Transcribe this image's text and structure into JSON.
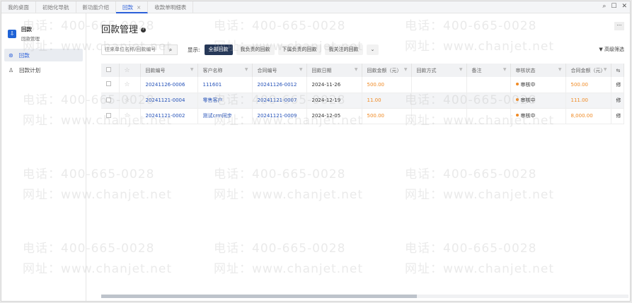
{
  "tabs": [
    {
      "label": "我的桌面"
    },
    {
      "label": "初始化导航"
    },
    {
      "label": "新功能介绍"
    },
    {
      "label": "回款",
      "active": true,
      "close": "×"
    },
    {
      "label": "收款单明细表"
    }
  ],
  "window_controls": {
    "search": "⌕",
    "maximize": "☐",
    "close": "✕"
  },
  "app": {
    "icon": "download-icon",
    "title": "回款",
    "subtitle": "回款管理"
  },
  "sidebar": {
    "items": [
      {
        "label": "回款",
        "icon": "payment-icon",
        "active": true
      },
      {
        "label": "回款计划",
        "icon": "plan-icon"
      }
    ]
  },
  "page": {
    "title": "回款管理",
    "help": "?",
    "more": "···"
  },
  "toolbar": {
    "search_placeholder": "往来单位名称/回款编号",
    "show_label": "显示:",
    "filters": [
      "全部回款",
      "我负责的回款",
      "下属负责的回款",
      "我关注的回款"
    ],
    "active_filter": "全部回款",
    "expand": "⌄",
    "advanced": "▼ 高级筛选"
  },
  "table": {
    "columns": [
      "回款编号",
      "客户名称",
      "合同编号",
      "回款日期",
      "回款金额（元）",
      "回款方式",
      "备注",
      "审核状态",
      "合同金额（元）"
    ],
    "rows": [
      [
        "20241126-0006",
        "111601",
        "20241126-0012",
        "2024-11-26",
        "500.00",
        "",
        "",
        "审核中",
        "500.00",
        "修"
      ],
      [
        "20241121-0004",
        "零售客户",
        "20241121-0007",
        "2024-12-19",
        "11.00",
        "",
        "",
        "审核中",
        "111.00",
        "修"
      ],
      [
        "20241121-0002",
        "测试crm同步",
        "20241121-0009",
        "2024-12-05",
        "500.00",
        "",
        "",
        "审核中",
        "8,000.00",
        "修"
      ]
    ]
  },
  "colors": {
    "accent": "#2b5fd9",
    "link": "#2451b8",
    "amount": "#f08a24",
    "active_filter_bg": "#263858"
  },
  "horizontal_scroll_fraction": 0.6,
  "watermark": {
    "phone": "电话：400-665-0028",
    "site": "网址：www.chanjet.net"
  }
}
